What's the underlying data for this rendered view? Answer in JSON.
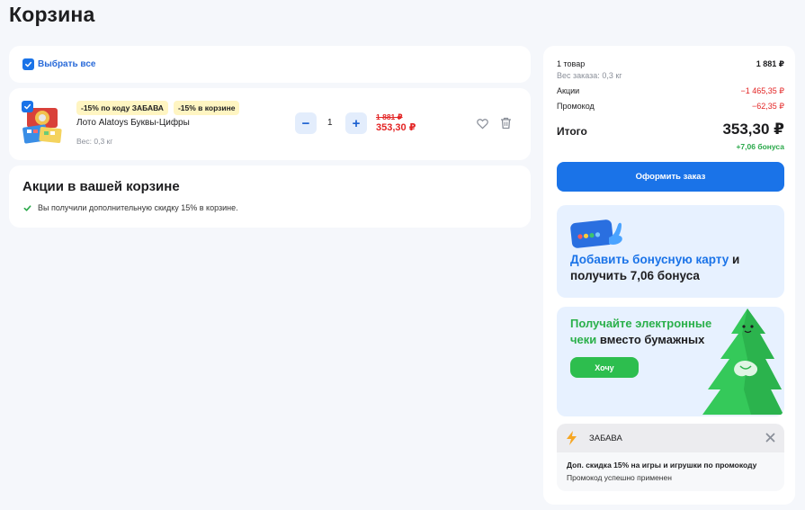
{
  "page": {
    "title": "Корзина"
  },
  "cart": {
    "select_all_label": "Выбрать все",
    "item": {
      "badges": [
        "-15% по коду ЗАБАВА",
        "-15% в корзине"
      ],
      "name": "Лото Alatoys Буквы-Цифры",
      "weight": "Вес: 0,3 кг",
      "quantity": "1",
      "minus_label": "−",
      "plus_label": "+",
      "old_price": "1 881 ₽",
      "new_price": "353,30 ₽"
    },
    "promotions": {
      "title": "Акции в вашей корзине",
      "message": "Вы получили дополнительную скидку 15% в корзине."
    }
  },
  "summary": {
    "items_label": "1 товар",
    "items_value": "1 881 ₽",
    "weight_label": "Вес заказа: 0,3 кг",
    "promos_label": "Акции",
    "promos_value": "−1 465,35 ₽",
    "promocode_label": "Промокод",
    "promocode_value": "−62,35 ₽",
    "total_label": "Итого",
    "total_value": "353,30 ₽",
    "bonus": "+7,06 бонуса",
    "order_button": "Оформить заказ"
  },
  "bonus_banner": {
    "text_blue": "Добавить бонусную карту",
    "text_rest_1": " и",
    "text_rest_2": "получить 7,06 бонуса"
  },
  "eco_banner": {
    "line1": "Получайте электронные",
    "line2_green": "чеки",
    "line2_rest": " вместо бумажных",
    "button": "Хочу"
  },
  "promo_code": {
    "code": "ЗАБАВА",
    "description": "Доп. скидка 15% на игры и игрушки по промокоду",
    "status": "Промокод успешно применен"
  },
  "colors": {
    "accent": "#1a73e8",
    "discount": "#e32424",
    "bonus": "#2aa84a",
    "eco_green": "#2dbe4e",
    "badge_bg": "#fff5c2"
  }
}
